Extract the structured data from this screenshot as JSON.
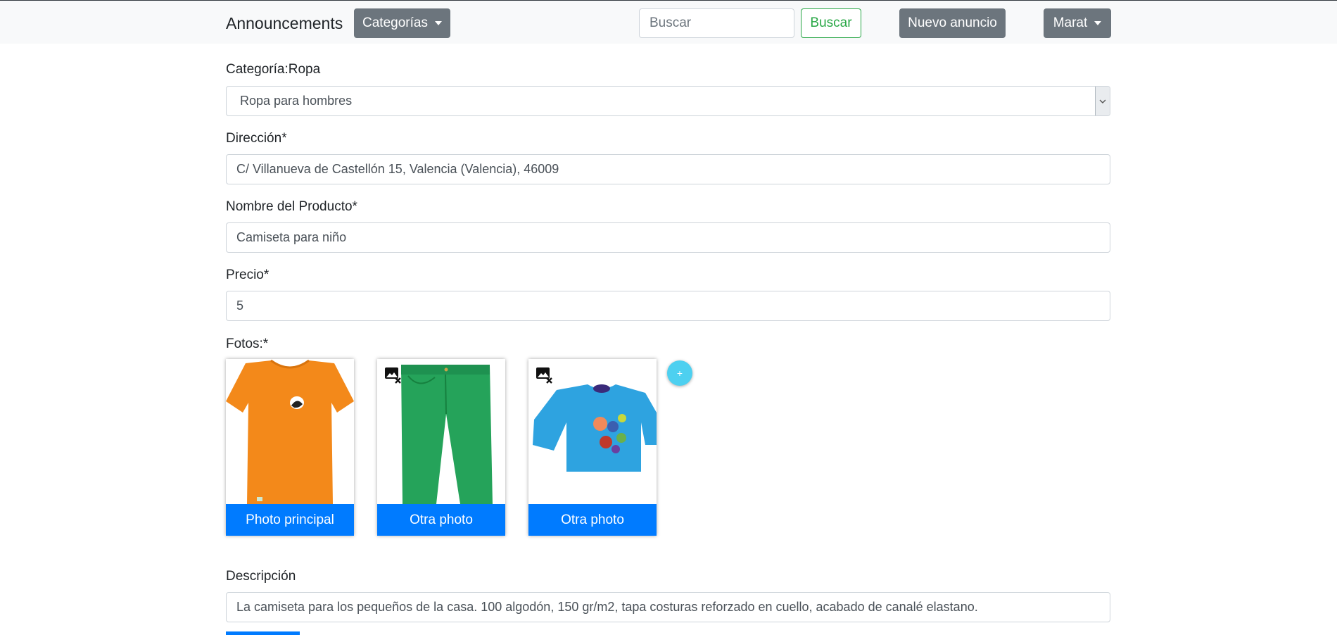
{
  "navbar": {
    "brand": "Announcements",
    "categories_label": "Categorías",
    "search_placeholder": "Buscar",
    "search_button": "Buscar",
    "new_ad_button": "Nuevo anuncio",
    "user_menu_label": "Marat"
  },
  "form": {
    "category_label": "Categoría:Ropa",
    "subcategory_value": "Ropa para hombres",
    "address_label": "Dirección*",
    "address_value": "C/ Villanueva de Castellón 15, Valencia (Valencia), 46009",
    "product_label": "Nombre del Producto*",
    "product_value": "Camiseta para niño",
    "price_label": "Precio*",
    "price_value": "5",
    "photos_label": "Fotos:*",
    "photos": [
      {
        "button": "Photo principal",
        "image": "orange-t-shirt"
      },
      {
        "button": "Otra photo",
        "image": "green-pants"
      },
      {
        "button": "Otra photo",
        "image": "blue-long-sleeve-shirt"
      }
    ],
    "add_photo_symbol": "+",
    "description_label": "Descripción",
    "description_value": "La camiseta para los pequeños de la casa. 100 algodón, 150 gr/m2, tapa costuras reforzado en cuello, acabado de canalé elastano."
  },
  "colors": {
    "primary": "#007bff",
    "secondary": "#6c757d",
    "success": "#28a745",
    "add_button": "#4dd0f0"
  },
  "icons": {
    "remove_photo": "image-remove-icon",
    "dropdown": "caret-down-icon",
    "select": "chevron-down-icon",
    "add": "plus-icon"
  }
}
